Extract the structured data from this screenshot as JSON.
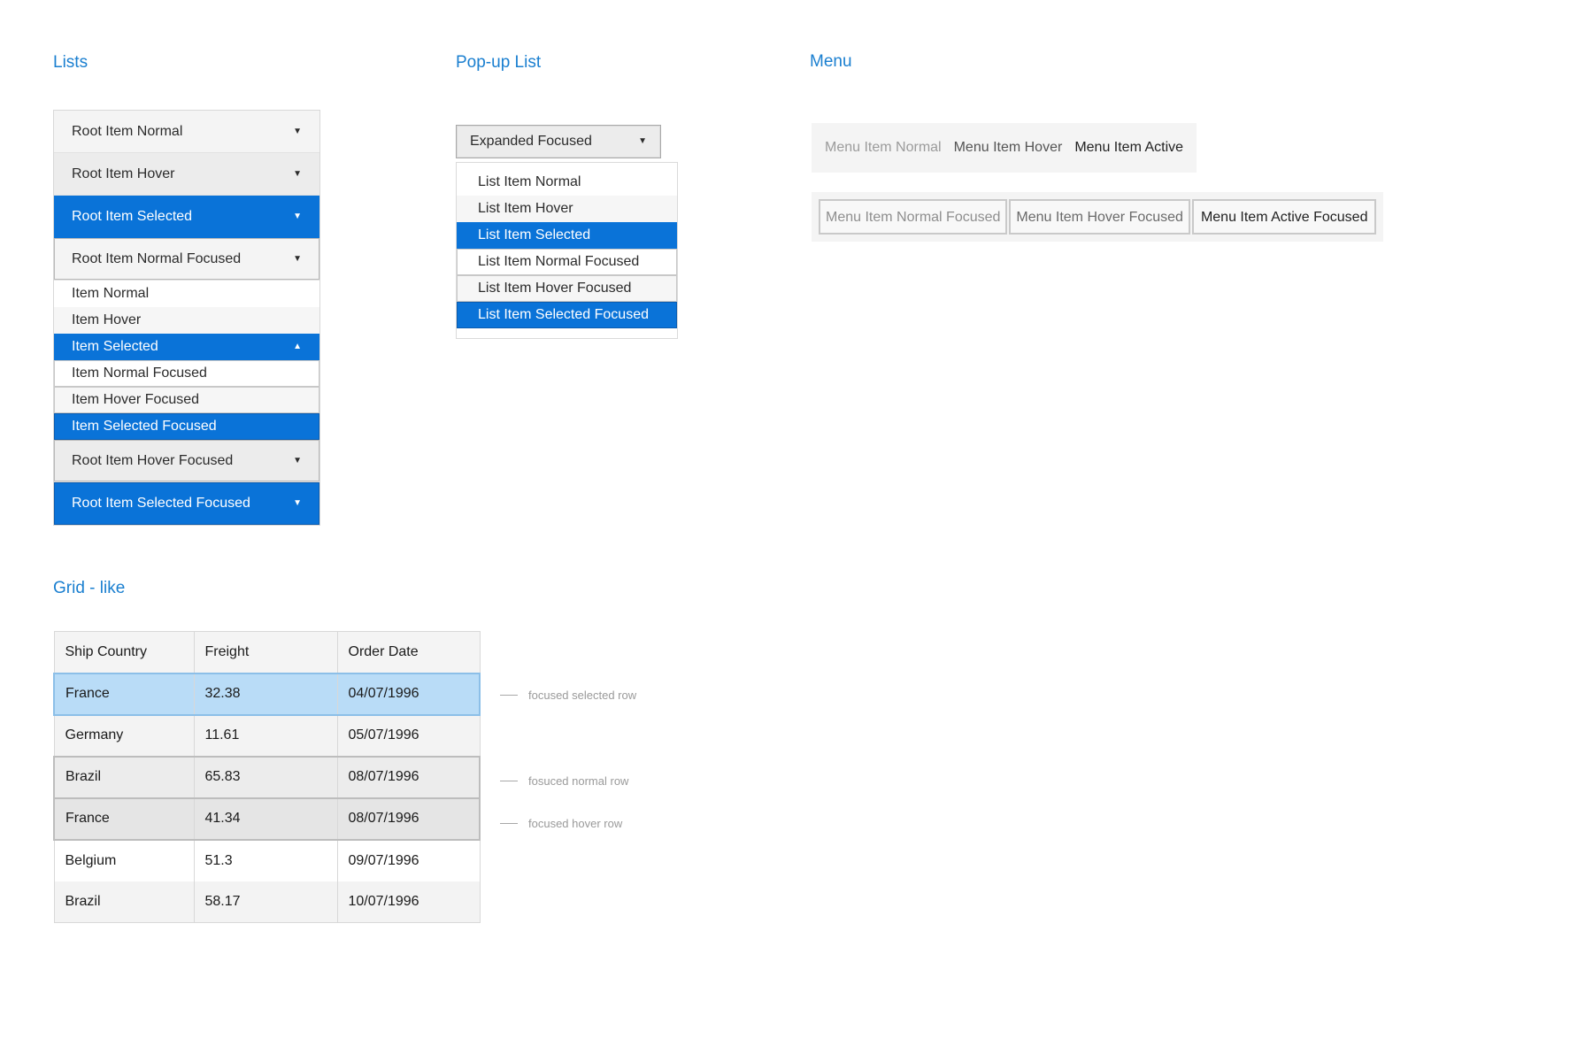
{
  "sections": {
    "lists": "Lists",
    "popup": "Pop-up List",
    "menu": "Menu",
    "grid": "Grid - like"
  },
  "lists": {
    "root_normal": "Root Item Normal",
    "root_hover": "Root Item Hover",
    "root_selected": "Root Item Selected",
    "root_normal_focused": "Root Item Normal Focused",
    "items": [
      "Item Normal",
      "Item Hover",
      "Item Selected",
      "Item Normal Focused",
      "Item Hover Focused",
      "Item Selected Focused"
    ],
    "root_hover_focused": "Root Item Hover Focused",
    "root_selected_focused": "Root Item Selected Focused"
  },
  "popup": {
    "dropdown_label": "Expanded Focused",
    "items": [
      "List Item Normal",
      "List Item Hover",
      "List Item Selected",
      "List Item Normal Focused",
      "List Item Hover Focused",
      "List Item Selected Focused"
    ]
  },
  "menu": {
    "items": [
      "Menu Item Normal",
      "Menu Item Hover",
      "Menu Item Active"
    ],
    "focused_items": [
      "Menu Item Normal Focused",
      "Menu Item Hover Focused",
      "Menu Item Active Focused"
    ]
  },
  "grid": {
    "columns": [
      "Ship Country",
      "Freight",
      "Order Date"
    ],
    "rows": [
      [
        "France",
        "32.38",
        "04/07/1996"
      ],
      [
        "Germany",
        "11.61",
        "05/07/1996"
      ],
      [
        "Brazil",
        "65.83",
        "08/07/1996"
      ],
      [
        "France",
        "41.34",
        "08/07/1996"
      ],
      [
        "Belgium",
        "51.3",
        "09/07/1996"
      ],
      [
        "Brazil",
        "58.17",
        "10/07/1996"
      ]
    ],
    "annotations": [
      "focused selected row",
      "fosuced normal row",
      "focused hover row"
    ]
  },
  "colors": {
    "accent": "#0a73d8",
    "title": "#1a7fd0",
    "selected_row": "#b9dcf7"
  },
  "icons": {
    "arrow_down": "triangle-down-icon",
    "arrow_up": "triangle-up-icon"
  }
}
